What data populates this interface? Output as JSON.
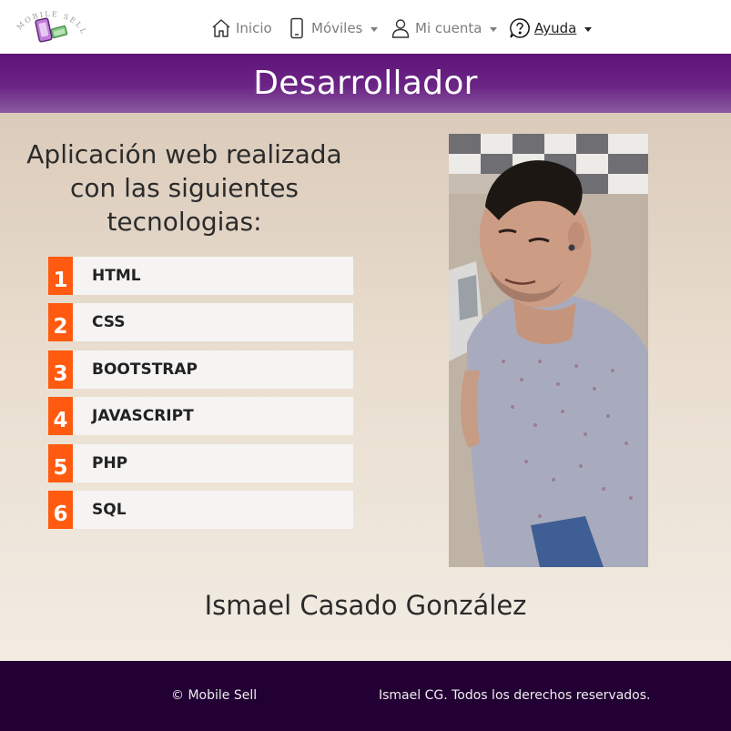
{
  "nav": {
    "logo_text": "MOBILE SELL",
    "items": [
      {
        "label": "Inicio",
        "icon": "house-icon"
      },
      {
        "label": "Móviles",
        "icon": "smartphone-icon"
      },
      {
        "label": "Mi cuenta",
        "icon": "user-icon"
      },
      {
        "label": "Ayuda",
        "icon": "help-bubble-icon"
      }
    ]
  },
  "banner": {
    "title": "Desarrollador"
  },
  "intro": {
    "text": "Aplicación web realizada con las siguientes tecnologias:"
  },
  "technologies": [
    {
      "num": "1",
      "name": "HTML"
    },
    {
      "num": "2",
      "name": "CSS"
    },
    {
      "num": "3",
      "name": "BOOTSTRAP"
    },
    {
      "num": "4",
      "name": "JAVASCRIPT"
    },
    {
      "num": "5",
      "name": "PHP"
    },
    {
      "num": "6",
      "name": "SQL"
    }
  ],
  "developer": {
    "name": "Ismael Casado González"
  },
  "footer": {
    "copyright": "© Mobile Sell",
    "rights": "Ismael CG. Todos los derechos reservados."
  },
  "colors": {
    "banner": "#6b2585",
    "number_badge": "#ff5a0f",
    "footer": "#220033"
  }
}
